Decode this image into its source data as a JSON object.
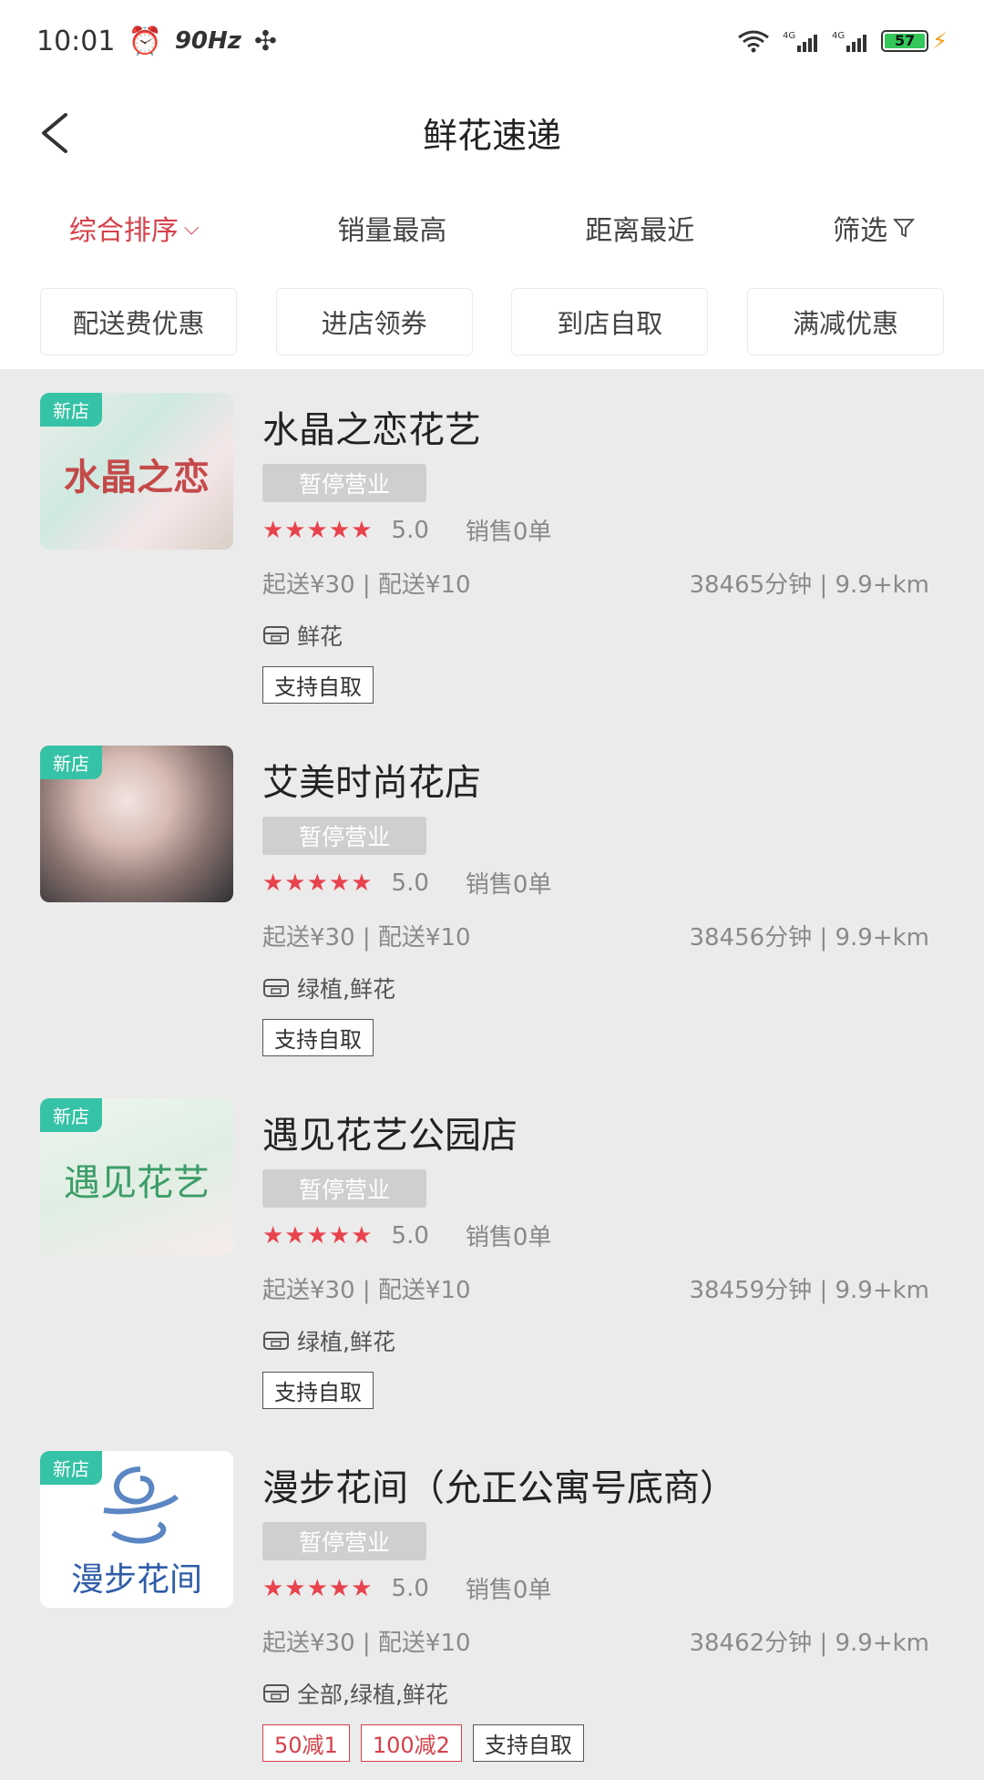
{
  "status_bar": {
    "time": "10:01",
    "refresh": "90Hz",
    "battery": "57"
  },
  "header": {
    "title": "鲜花速递"
  },
  "sort_options": [
    {
      "label": "综合排序",
      "active": true
    },
    {
      "label": "销量最高",
      "active": false
    },
    {
      "label": "距离最近",
      "active": false
    },
    {
      "label": "筛选",
      "active": false
    }
  ],
  "filter_chips": [
    "配送费优惠",
    "进店领券",
    "到店自取",
    "满减优惠"
  ],
  "shops": [
    {
      "badge": "新店",
      "thumb_text": "水晶之恋",
      "name": "水晶之恋花艺",
      "status": "暂停营业",
      "score": "5.0",
      "sales": "销售0单",
      "delivery": "起送¥30 | 配送¥10",
      "eta": "38465分钟 | 9.9+km",
      "category": "鲜花",
      "tags": [
        "支持自取"
      ]
    },
    {
      "badge": "新店",
      "thumb_text": "",
      "name": "艾美时尚花店",
      "status": "暂停营业",
      "score": "5.0",
      "sales": "销售0单",
      "delivery": "起送¥30 | 配送¥10",
      "eta": "38456分钟 | 9.9+km",
      "category": "绿植,鲜花",
      "tags": [
        "支持自取"
      ]
    },
    {
      "badge": "新店",
      "thumb_text": "遇见花艺",
      "name": "遇见花艺公园店",
      "status": "暂停营业",
      "score": "5.0",
      "sales": "销售0单",
      "delivery": "起送¥30 | 配送¥10",
      "eta": "38459分钟 | 9.9+km",
      "category": "绿植,鲜花",
      "tags": [
        "支持自取"
      ]
    },
    {
      "badge": "新店",
      "thumb_text": "漫步花间",
      "name": "漫步花间（允正公寓号底商）",
      "status": "暂停营业",
      "score": "5.0",
      "sales": "销售0单",
      "delivery": "起送¥30 | 配送¥10",
      "eta": "38462分钟 | 9.9+km",
      "category": "全部,绿植,鲜花",
      "tags": [
        "50减1",
        "100减2",
        "支持自取"
      ]
    }
  ]
}
